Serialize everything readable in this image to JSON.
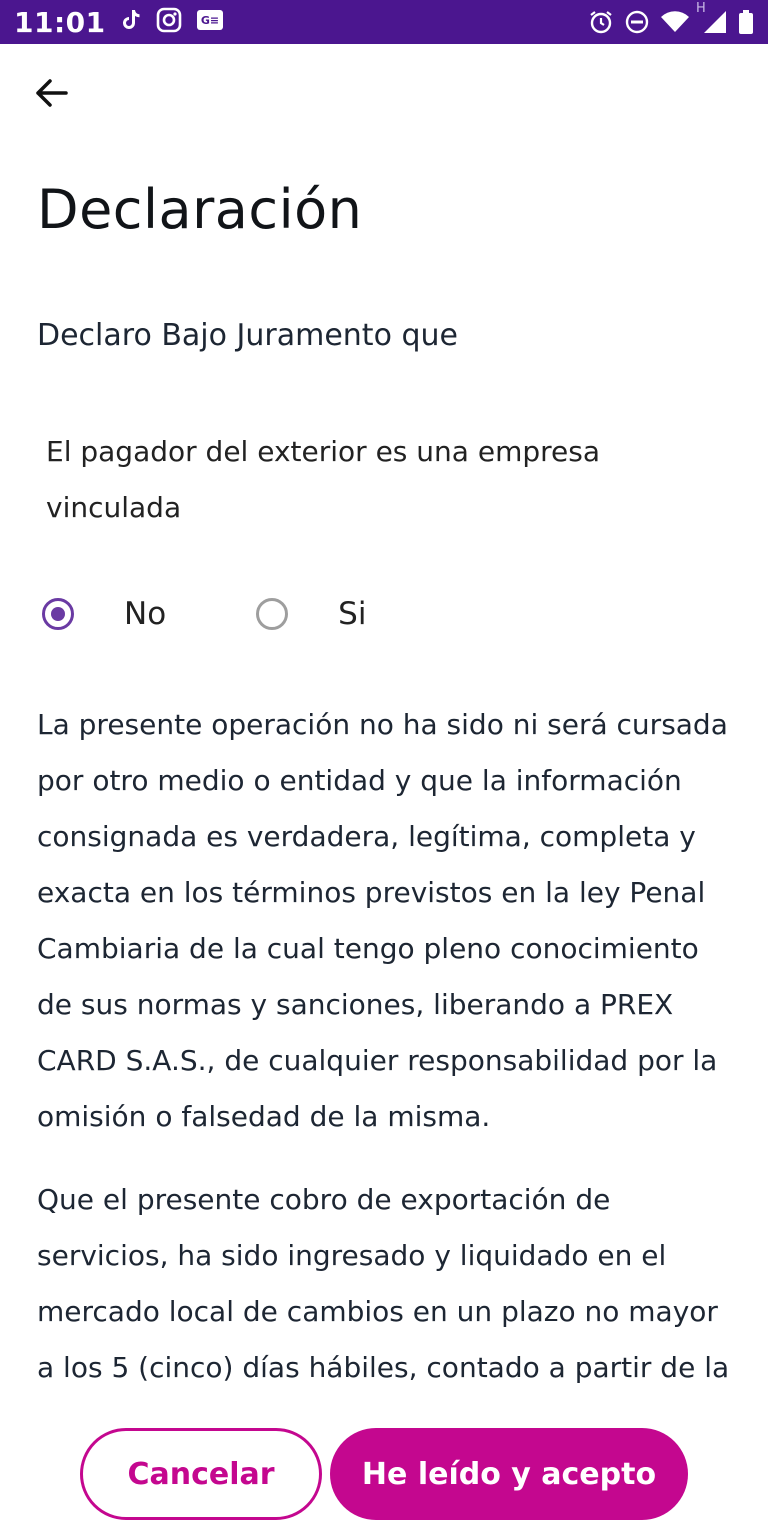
{
  "status_bar": {
    "time": "11:01",
    "left_icons": [
      "tiktok-icon",
      "instagram-icon",
      "news-icon"
    ],
    "right_icons": [
      "alarm-icon",
      "do-not-disturb-icon",
      "wifi-icon",
      "signal-icon",
      "battery-icon"
    ],
    "network_label": "H",
    "background_color": "#4b168f"
  },
  "header": {
    "back_icon": "arrow-left-icon",
    "title": "Declaración"
  },
  "content": {
    "subtitle": "Declaro Bajo Juramento que",
    "question": "El pagador del exterior es una empresa vinculada",
    "radio_options": [
      {
        "label": "No",
        "selected": true
      },
      {
        "label": "Si",
        "selected": false
      }
    ],
    "paragraph_1": "La presente operación no ha sido ni será cursada por otro medio o entidad y que la información consignada es verdadera, legítima, completa y exacta en los términos previstos en la ley Penal Cambiaria de la cual tengo pleno conocimiento de sus normas y sanciones, liberando a PREX CARD S.A.S., de cualquier responsabilidad por la omisión o falsedad de la misma.",
    "paragraph_2": "Que el presente cobro de exportación de servicios, ha sido ingresado y liquidado en el mercado local de cambios en un plazo no mayor a los 5 (cinco) días hábiles, contado a partir de la"
  },
  "actions": {
    "cancel_label": "Cancelar",
    "accept_label": "He leído y acepto",
    "accent_color": "#c4078f",
    "radio_color": "#6a3aa3"
  }
}
